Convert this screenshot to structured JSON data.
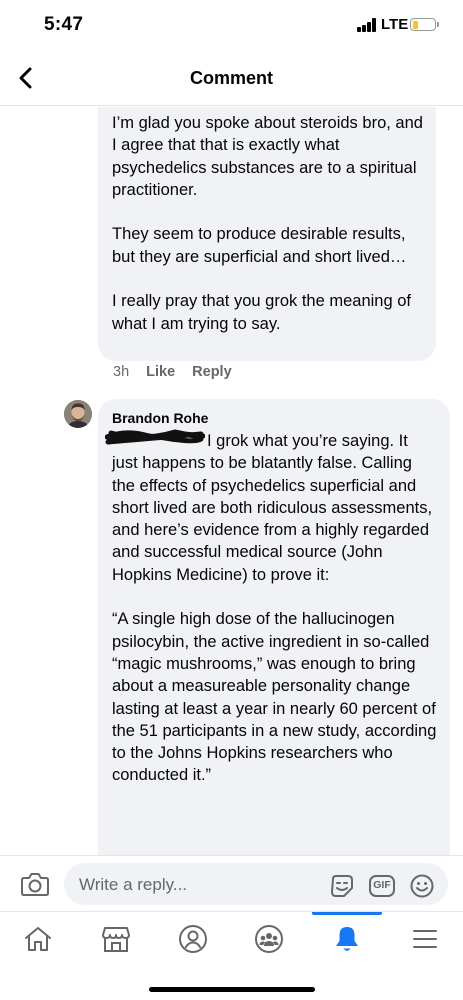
{
  "status_bar": {
    "time": "5:47",
    "network": "LTE",
    "battery_level": 0.25,
    "battery_color": "#f4c430"
  },
  "header": {
    "title": "Comment",
    "back_icon": "chevron-left-icon"
  },
  "comments": [
    {
      "paragraphs": [
        "I’m glad you spoke about steroids bro, and I agree that that is exactly what psychedelics substances are to a spiritual practitioner.",
        "They seem to produce desirable results, but they are superficial and short lived…",
        "I really pray that you grok the meaning of what I am trying to say."
      ],
      "time": "3h",
      "like_label": "Like",
      "reply_label": "Reply"
    },
    {
      "author": "Brandon Rohe",
      "paragraphs": [
        "I grok what you’re saying. It just happens to be blatantly false. Calling the effects of psychedelics superficial and short lived are both ridiculous assessments, and here’s evidence from a highly regarded and successful medical source (John Hopkins Medicine) to prove it:",
        "“A single high dose of the hallucinogen psilocybin, the active ingredient in so-called “magic mushrooms,” was enough to bring about a measureable personality change lasting at least a year in nearly 60 percent of the 51 participants in a new study, according to the Johns Hopkins researchers who conducted it.”"
      ]
    }
  ],
  "composer": {
    "placeholder": "Write a reply...",
    "gif_label": "GIF",
    "icons": [
      "camera-icon",
      "sticker-icon",
      "gif-icon",
      "emoji-icon"
    ]
  },
  "tab_bar": {
    "tabs": [
      "home-icon",
      "marketplace-icon",
      "profile-icon",
      "groups-icon",
      "notifications-icon",
      "menu-icon"
    ],
    "active_tab": "notifications-icon",
    "accent_color": "#1877f2"
  }
}
